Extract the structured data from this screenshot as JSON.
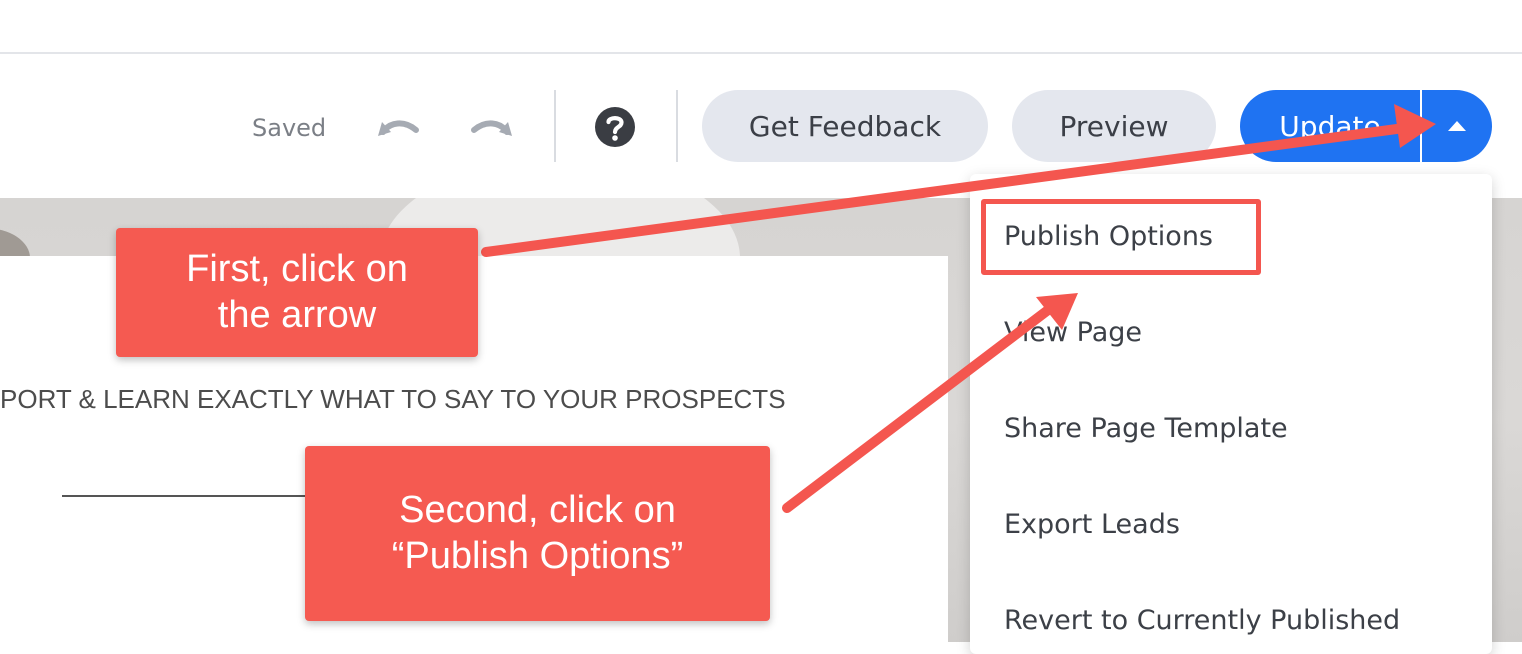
{
  "toolbar": {
    "saved_label": "Saved",
    "get_feedback_label": "Get Feedback",
    "preview_label": "Preview",
    "update_label": "Update"
  },
  "page": {
    "headline": "PORT & LEARN EXACTLY WHAT TO SAY TO YOUR PROSPECTS"
  },
  "dropdown": {
    "items": [
      {
        "label": "Publish Options"
      },
      {
        "label": "View Page"
      },
      {
        "label": "Share Page Template"
      },
      {
        "label": "Export Leads"
      },
      {
        "label": "Revert to Currently Published"
      }
    ]
  },
  "annotations": {
    "callout_1": {
      "line_1": "First, click on",
      "line_2": "the arrow"
    },
    "callout_2": {
      "line_1": "Second, click on",
      "line_2": "“Publish Options”"
    }
  },
  "colors": {
    "primary": "#1f73f2",
    "callout": "#f55a51",
    "pill": "#e4e7ee"
  },
  "icons": [
    "undo-icon",
    "redo-icon",
    "help-icon",
    "caret-up-icon"
  ]
}
